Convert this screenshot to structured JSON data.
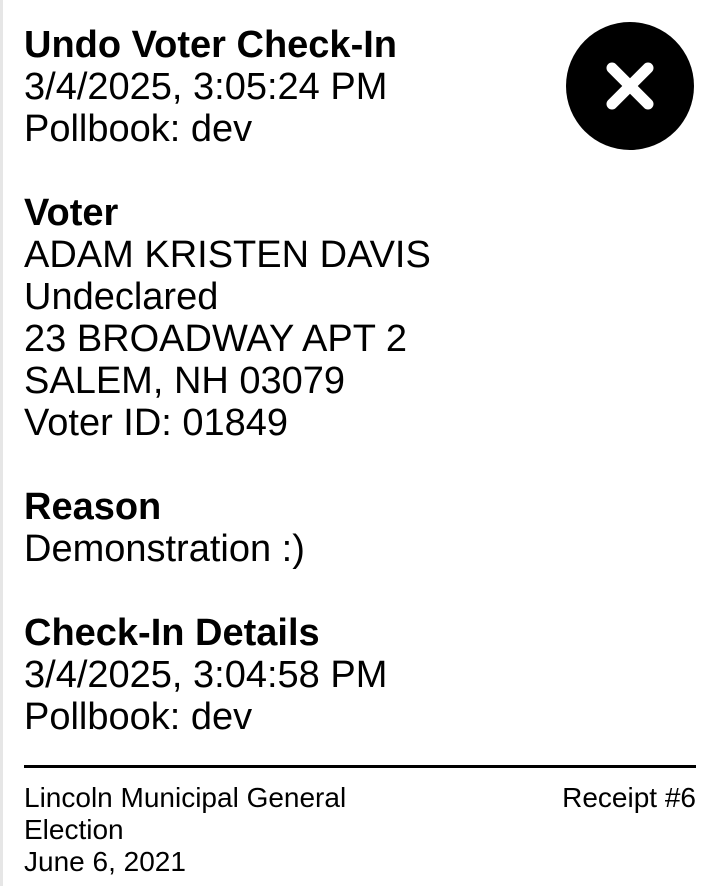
{
  "header": {
    "title": "Undo Voter Check-In",
    "timestamp": "3/4/2025, 3:05:24 PM",
    "pollbook": "Pollbook: dev"
  },
  "close_icon": {
    "icon": "close-icon",
    "background_color": "#000000",
    "glyph_color": "#ffffff"
  },
  "voter": {
    "heading": "Voter",
    "name": "ADAM KRISTEN DAVIS",
    "party": "Undeclared",
    "address_line1": "23 BROADWAY APT 2",
    "address_line2": "SALEM, NH 03079",
    "voter_id": "Voter ID: 01849"
  },
  "reason": {
    "heading": "Reason",
    "text": "Demonstration :)"
  },
  "check_in_details": {
    "heading": "Check-In Details",
    "timestamp": "3/4/2025, 3:04:58 PM",
    "pollbook": "Pollbook: dev"
  },
  "footer": {
    "election_name": "Lincoln Municipal General Election",
    "election_date": "June 6, 2021",
    "receipt_number": "Receipt #6"
  }
}
